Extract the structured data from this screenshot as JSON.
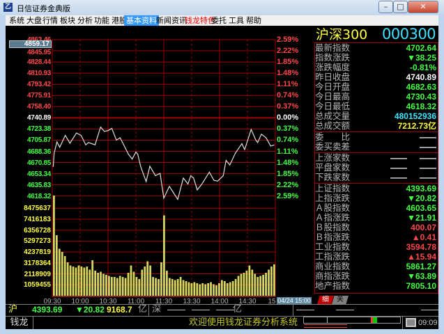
{
  "window": {
    "title": "日信证券金典版",
    "icon": "qianlong-logo-icon",
    "minimize": "–",
    "maximize": "□",
    "close": "✕"
  },
  "menu": [
    {
      "label": "系统"
    },
    {
      "label": "大盘"
    },
    {
      "label": "行情"
    },
    {
      "label": "板块"
    },
    {
      "label": "分析"
    },
    {
      "label": "功能"
    },
    {
      "label": "港股"
    },
    {
      "label": "基本资料",
      "active": true
    },
    {
      "label": "新闻资讯"
    },
    {
      "label": "钱龙特色",
      "highlight": "#ff0000"
    },
    {
      "label": "委托"
    },
    {
      "label": "工具"
    },
    {
      "label": "帮助"
    }
  ],
  "colors": {
    "up": "#ff4848",
    "down": "#44ff44",
    "grid": "#a00000",
    "volume": "#d8d860",
    "line": "#e0e0e0"
  },
  "chart": {
    "cursor_value": "4859.17",
    "date_label": "04/24 15:00",
    "price_axis": [
      "4863.46",
      "4845.95",
      "4828.44",
      "4810.93",
      "4793.42",
      "4775.91",
      "4758.40",
      "4740.89",
      "4723.38",
      "4705.87",
      "4688.36",
      "4670.85",
      "4653.34",
      "4635.83",
      "4618.32"
    ],
    "pct_axis": [
      "2.59%",
      "2.22%",
      "1.85%",
      "1.48%",
      "1.11%",
      "0.74%",
      "0.37%",
      "0.00%",
      "0.37%",
      "0.74%",
      "1.11%",
      "1.48%",
      "1.85%",
      "2.22%",
      "2.59%"
    ],
    "volume_axis": [
      "8475637",
      "7416183",
      "6356728",
      "5297273",
      "4237819",
      "3178364",
      "2118909",
      "1059455"
    ],
    "time_axis": [
      "09:30",
      "10:00",
      "10:30",
      "11:00",
      "11:30",
      "13:30",
      "14:00",
      "14:30",
      "15"
    ]
  },
  "chart_data": {
    "type": "line",
    "prev_close": 4740.89,
    "ylim": [
      4618.32,
      4863.46
    ],
    "price": {
      "x": [
        "09:31",
        "09:32",
        "09:35",
        "09:38",
        "09:44",
        "09:49",
        "09:56",
        "10:01",
        "10:06",
        "10:09",
        "10:16",
        "10:22",
        "10:26",
        "10:30",
        "10:34",
        "10:39",
        "10:43",
        "10:52",
        "10:56",
        "11:00",
        "11:02",
        "11:05",
        "11:11",
        "11:15",
        "11:21",
        "11:26",
        "11:30",
        "13:06",
        "13:15",
        "13:21",
        "13:26",
        "13:29",
        "13:32",
        "13:36",
        "13:41",
        "13:49",
        "13:54",
        "13:58",
        "14:04",
        "14:07",
        "14:11",
        "14:17",
        "14:24",
        "14:27",
        "14:34",
        "14:39",
        "14:41",
        "14:45",
        "14:50",
        "14:55",
        "14:59"
      ],
      "y": [
        4664.0,
        4685.5,
        4703.3,
        4694.8,
        4713.4,
        4701.1,
        4717.1,
        4713.4,
        4698.5,
        4702.2,
        4698.5,
        4726.4,
        4719.7,
        4720.8,
        4724.5,
        4706.0,
        4709.7,
        4683.7,
        4676.2,
        4687.4,
        4683.7,
        4665.1,
        4640.9,
        4665.1,
        4650.2,
        4653.9,
        4614.9,
        4633.5,
        4613.0,
        4646.5,
        4637.2,
        4650.2,
        4646.5,
        4627.9,
        4637.2,
        4655.8,
        4642.8,
        4641.7,
        4650.2,
        4674.3,
        4667.0,
        4685.5,
        4700.4,
        4691.1,
        4722.7,
        4706.0,
        4702.2,
        4715.3,
        4709.7,
        4696.6,
        4698.5
      ]
    },
    "volume": {
      "interval_minutes": 3,
      "ylim": [
        0,
        9534092
      ],
      "values_millions": [
        9.6,
        5.8,
        4.5,
        4.2,
        3.8,
        3.2,
        2.9,
        2.8,
        2.7,
        2.9,
        2.8,
        2.7,
        2.8,
        2.5,
        3.4,
        2.4,
        2.2,
        2.3,
        2.1,
        2.0,
        1.9,
        1.8,
        1.8,
        1.7,
        1.9,
        1.8,
        1.7,
        2.2,
        2.9,
        2.3,
        1.8,
        1.6,
        2.5,
        2.8,
        3.3,
        2.9,
        1.8,
        1.7,
        1.6,
        3.2,
        7.7,
        2.4,
        1.7,
        1.6,
        1.5,
        1.6,
        1.8,
        1.5,
        1.4,
        1.3,
        1.2,
        1.3,
        1.2,
        1.1,
        1.2,
        1.1,
        1.2,
        1.3,
        1.1,
        1.0,
        1.2,
        1.5,
        1.4,
        1.2,
        1.3,
        1.4,
        1.6,
        1.9,
        2.1,
        2.2,
        2.4,
        2.9,
        2.5,
        2.1,
        1.8,
        1.9,
        2.0,
        2.2,
        2.5,
        2.8,
        3.0
      ]
    }
  },
  "panel": {
    "name": "沪深300",
    "code": "000300",
    "sections": [
      [
        {
          "label": "最新指数",
          "value": "4702.64",
          "color": "g"
        },
        {
          "label": "指数涨跌",
          "value": "▼38.25",
          "color": "g"
        },
        {
          "label": "涨跌幅度",
          "value": "-0.81%",
          "color": "g",
          "plain": true
        },
        {
          "label": "昨日收盘",
          "value": "4740.89",
          "color": "w"
        },
        {
          "label": "今日开盘",
          "value": "4682.63",
          "color": "g"
        },
        {
          "label": "今日最高",
          "value": "4730.43",
          "color": "g"
        },
        {
          "label": "今日最低",
          "value": "4618.32",
          "color": "g"
        },
        {
          "label": "总成交量",
          "value": "480152936",
          "color": "c",
          "plain": true
        },
        {
          "label": "总成交额",
          "value": "7212.73亿",
          "color": "y",
          "plain": true
        }
      ],
      [
        {
          "label": "委　　比",
          "value": "——",
          "color": "w",
          "plain": true
        },
        {
          "label": "委买卖差",
          "value": "——",
          "color": "w",
          "plain": true
        }
      ],
      [
        {
          "label": "上涨家数",
          "value": "——",
          "value2": "——",
          "color": "w",
          "plain": true
        },
        {
          "label": "平盘家数",
          "value": "——",
          "value2": "——",
          "color": "w",
          "plain": true
        },
        {
          "label": "下跌家数",
          "value": "——",
          "value2": "——",
          "color": "w",
          "plain": true
        }
      ],
      [
        {
          "label": "上证指数",
          "value": "4393.69",
          "color": "g"
        },
        {
          "label": "上指涨跌",
          "value": "▼20.82",
          "color": "g"
        },
        {
          "label": "Ａ股指数",
          "value": "4603.65",
          "color": "g"
        },
        {
          "label": "Ａ指涨跌",
          "value": "▼21.91",
          "color": "g"
        },
        {
          "label": "Ｂ股指数",
          "value": "400.07",
          "color": "r"
        },
        {
          "label": "Ｂ指涨跌",
          "value": "▲0.41",
          "color": "r"
        },
        {
          "label": "工业指数",
          "value": "3594.78",
          "color": "r"
        },
        {
          "label": "工指涨跌",
          "value": "▲15.94",
          "color": "r"
        },
        {
          "label": "商业指数",
          "value": "5861.27",
          "color": "g"
        },
        {
          "label": "商指涨跌",
          "value": "▼63.89",
          "color": "g"
        },
        {
          "label": "地产指数",
          "value": "7805.10",
          "color": "g"
        }
      ]
    ],
    "tabs": [
      {
        "label": "细",
        "active": true
      },
      {
        "label": "关"
      }
    ]
  },
  "statusbar": {
    "sh_label": "沪",
    "sh_index": "4393.69",
    "sh_change": "▼20.82",
    "sh_amount": "9168.7",
    "unit": "亿",
    "sz_label": "深",
    "sz_index": "——",
    "sz_change": "——",
    "sz_amount": "——",
    "sz_unit": "亿",
    "extra": "——",
    "right1": "——",
    "right2": "——"
  },
  "bottombar": {
    "brand": "钱龙",
    "marquee": "欢迎使用钱龙证券分析系统",
    "time": "09:09",
    "screen_icon": "monitor-icon"
  }
}
